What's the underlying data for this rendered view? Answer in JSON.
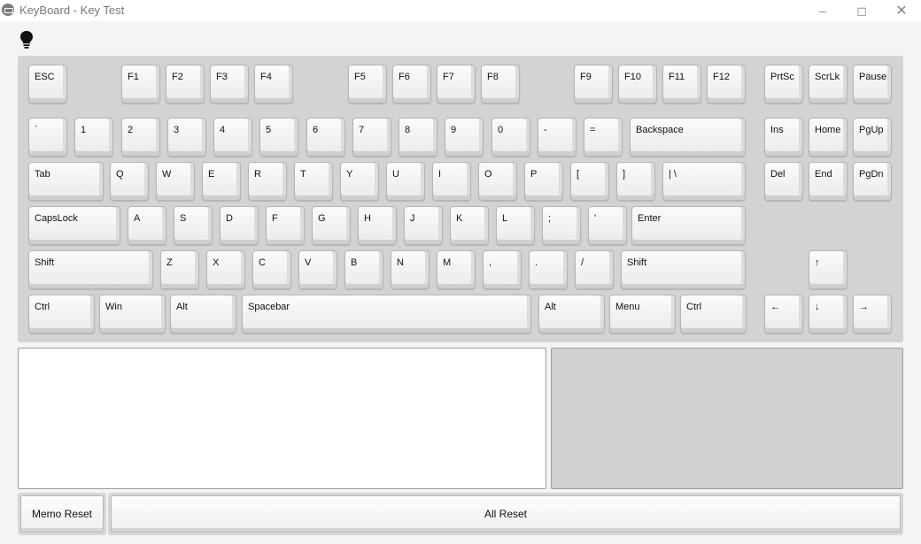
{
  "window": {
    "title": "KeyBoard - Key Test"
  },
  "rows": {
    "fn": [
      "ESC",
      "F1",
      "F2",
      "F3",
      "F4",
      "F5",
      "F6",
      "F7",
      "F8",
      "F9",
      "F10",
      "F11",
      "F12",
      "PrtSc",
      "ScrLk",
      "Pause"
    ],
    "num": [
      "`",
      "1",
      "2",
      "3",
      "4",
      "5",
      "6",
      "7",
      "8",
      "9",
      "0",
      "-",
      "=",
      "Backspace",
      "Ins",
      "Home",
      "PgUp"
    ],
    "tab": [
      "Tab",
      "Q",
      "W",
      "E",
      "R",
      "T",
      "Y",
      "U",
      "I",
      "O",
      "P",
      "[",
      "]",
      "| \\",
      "Del",
      "End",
      "PgDn"
    ],
    "caps": [
      "CapsLock",
      "A",
      "S",
      "D",
      "F",
      "G",
      "H",
      "J",
      "K",
      "L",
      ";",
      "'",
      "Enter"
    ],
    "shift": [
      "Shift",
      "Z",
      "X",
      "C",
      "V",
      "B",
      "N",
      "M",
      ",",
      ".",
      "/",
      "Shift",
      "↑"
    ],
    "bottom": [
      "Ctrl",
      "Win",
      "Alt",
      "Spacebar",
      "Alt",
      "Menu",
      "Ctrl",
      "←",
      "↓",
      "→"
    ]
  },
  "memo": {
    "value": ""
  },
  "buttons": {
    "memo_reset": "Memo Reset",
    "all_reset": "All Reset"
  }
}
